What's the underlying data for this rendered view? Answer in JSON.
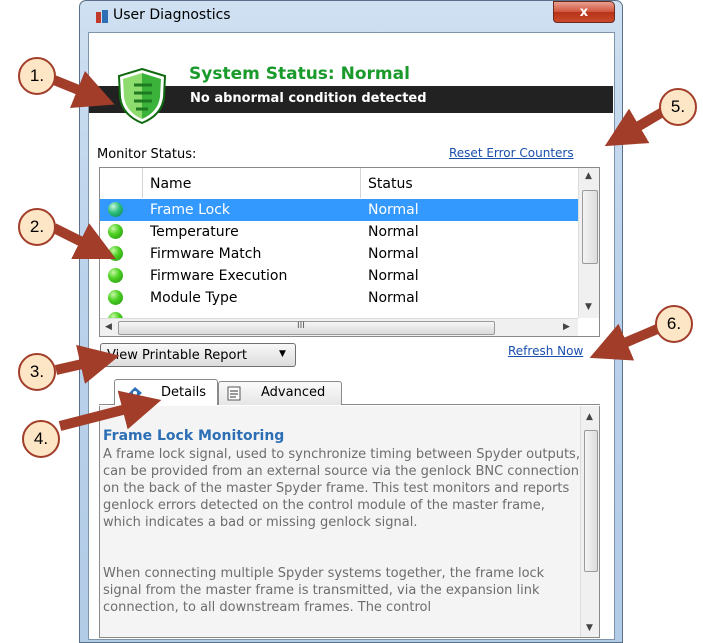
{
  "window": {
    "title": "User Diagnostics",
    "close_glyph": "x"
  },
  "status": {
    "title": "System Status: Normal",
    "subtitle": "No abnormal condition detected",
    "icon": "shield-icon"
  },
  "monitor": {
    "label": "Monitor Status:",
    "reset_link": "Reset Error Counters"
  },
  "table": {
    "headers": [
      "Name",
      "Status"
    ],
    "rows": [
      {
        "name": "Frame Lock",
        "status": "Normal",
        "selected": true
      },
      {
        "name": "Temperature",
        "status": "Normal",
        "selected": false
      },
      {
        "name": "Firmware Match",
        "status": "Normal",
        "selected": false
      },
      {
        "name": "Firmware Execution",
        "status": "Normal",
        "selected": false
      },
      {
        "name": "Module Type",
        "status": "Normal",
        "selected": false
      }
    ],
    "hscroll_grip": "III"
  },
  "report": {
    "label": "View Printable Report"
  },
  "refresh_link": "Refresh Now",
  "tabs": [
    {
      "label": "Details",
      "active": true
    },
    {
      "label": "Advanced",
      "active": false
    }
  ],
  "details": {
    "title": "Frame Lock Monitoring",
    "para1": "A frame lock signal, used to synchronize timing between Spyder outputs, can be provided from an external source via the genlock BNC connection on the back of the master Spyder frame.  This test monitors and reports genlock errors detected on the control module of the master frame, which indicates a bad or missing genlock signal.",
    "para2": "When connecting multiple Spyder systems together, the frame lock signal from the master frame is transmitted, via the expansion link connection, to all downstream frames.  The control"
  },
  "callouts": [
    "1.",
    "2.",
    "3.",
    "4.",
    "5.",
    "6."
  ],
  "colors": {
    "accent_green": "#1a9a2b",
    "selection": "#3399ff",
    "callout_fill": "#fde6c6",
    "callout_arrow": "#a23d2a"
  }
}
